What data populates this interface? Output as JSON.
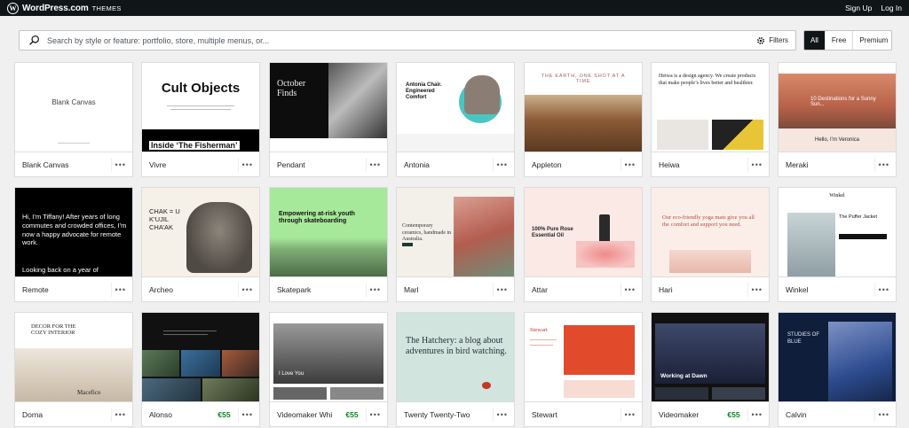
{
  "header": {
    "brand": "WordPress.com",
    "section": "THEMES",
    "signup": "Sign Up",
    "login": "Log In"
  },
  "search": {
    "placeholder": "Search by style or feature: portfolio, store, multiple menus, or...",
    "filters_label": "Filters"
  },
  "price_filter": [
    "All",
    "Free",
    "Premium"
  ],
  "themes": [
    {
      "name": "Blank Canvas",
      "price": ""
    },
    {
      "name": "Vivre",
      "price": ""
    },
    {
      "name": "Pendant",
      "price": ""
    },
    {
      "name": "Antonia",
      "price": ""
    },
    {
      "name": "Appleton",
      "price": ""
    },
    {
      "name": "Heiwa",
      "price": ""
    },
    {
      "name": "Meraki",
      "price": ""
    },
    {
      "name": "Remote",
      "price": ""
    },
    {
      "name": "Archeo",
      "price": ""
    },
    {
      "name": "Skatepark",
      "price": ""
    },
    {
      "name": "Marl",
      "price": ""
    },
    {
      "name": "Attar",
      "price": ""
    },
    {
      "name": "Hari",
      "price": ""
    },
    {
      "name": "Winkel",
      "price": ""
    },
    {
      "name": "Dorna",
      "price": ""
    },
    {
      "name": "Alonso",
      "price": "€55"
    },
    {
      "name": "Videomaker Whi",
      "price": "€55"
    },
    {
      "name": "Twenty Twenty-Two",
      "price": ""
    },
    {
      "name": "Stewart",
      "price": ""
    },
    {
      "name": "Videomaker",
      "price": "€55"
    },
    {
      "name": "Calvin",
      "price": ""
    }
  ],
  "more_label": "•••",
  "thumb_text": {
    "blank": "Blank Canvas",
    "vivre_title": "Cult Objects",
    "vivre_sub": "Inside ‘The Fisherman’",
    "pendant": "October Finds",
    "antonia": "Antonia Chair. Engineered Comfort",
    "appleton": "THE EARTH, ONE SHOT AT A TIME",
    "heiwa": "Heiwa is a design agency. We create products that make people’s lives better and healthier.",
    "meraki_banner": "10 Destinations for a Sunny Sun...",
    "meraki_hello": "Hello, I’m Veronica",
    "remote": "Hi, I’m Tiffany! After years of long commutes and crowded offices, I’m now a happy advocate for remote work.",
    "remote_more": "Looking back on a year of",
    "archeo": "CHAK = U K’UJIL CHA’AK",
    "skatepark": "Empowering at-risk youth through skateboarding",
    "marl": "Contemporary ceramics, handmade in Australia.",
    "attar": "100% Pure Rose Essential Oil",
    "hari": "Our eco-friendly yoga mats give you all the comfort and support you need.",
    "winkel_title": "Winkel",
    "winkel_item": "The Puffer Jacket",
    "dorna": "DECOR FOR THE COZY INTERIOR",
    "dorna_more": "Macefico",
    "videowhite": "I Love You",
    "ttt": "The Hatchery: a blog about adventures in bird watching.",
    "stewart": "Stewart",
    "videomaker": "Working at Dawn",
    "calvin": "STUDIES OF BLUE"
  }
}
